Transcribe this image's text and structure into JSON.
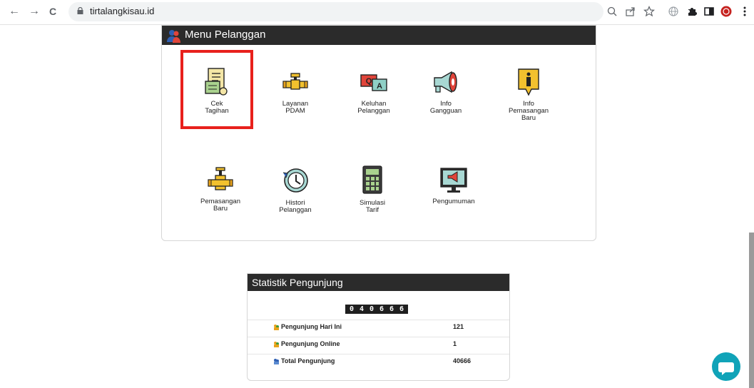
{
  "browser": {
    "url": "tirtalangkisau.id",
    "back_glyph": "←",
    "forward_glyph": "→",
    "reload_glyph": "C"
  },
  "menu_panel": {
    "title": "Menu Pelanggan",
    "items": [
      {
        "label_lines": [
          "Cek",
          "Tagihan"
        ],
        "icon": "bill-icon"
      },
      {
        "label_lines": [
          "Layanan",
          "PDAM"
        ],
        "icon": "pipe-valve-icon"
      },
      {
        "label_lines": [
          "Keluhan",
          "Pelanggan"
        ],
        "icon": "chat-complaint-icon"
      },
      {
        "label_lines": [
          "Info",
          "Gangguan"
        ],
        "icon": "megaphone-icon"
      },
      {
        "label_lines": [
          "Info",
          "Pemasangan",
          "Baru"
        ],
        "icon": "info-icon"
      },
      {
        "label_lines": [
          "Pemasangan",
          "Baru"
        ],
        "icon": "pipe-install-icon"
      },
      {
        "label_lines": [
          "Histori",
          "Pelanggan"
        ],
        "icon": "history-icon"
      },
      {
        "label_lines": [
          "Simulasi",
          "Tarif"
        ],
        "icon": "calculator-icon"
      },
      {
        "label_lines": [
          "Pengumuman"
        ],
        "icon": "monitor-announcement-icon"
      }
    ],
    "highlight_color": "#e8201c"
  },
  "stats_panel": {
    "title": "Statistik Pengunjung",
    "counter_digits": [
      "0",
      "4",
      "0",
      "6",
      "6",
      "6"
    ],
    "rows": [
      {
        "name": "Pengunjung Hari Ini",
        "value": "121"
      },
      {
        "name": "Pengunjung Online",
        "value": "1"
      },
      {
        "name": "Total Pengunjung",
        "value": "40666"
      }
    ]
  },
  "colors": {
    "header_bg": "#2b2b2b",
    "chat_button": "#10a3b8"
  }
}
